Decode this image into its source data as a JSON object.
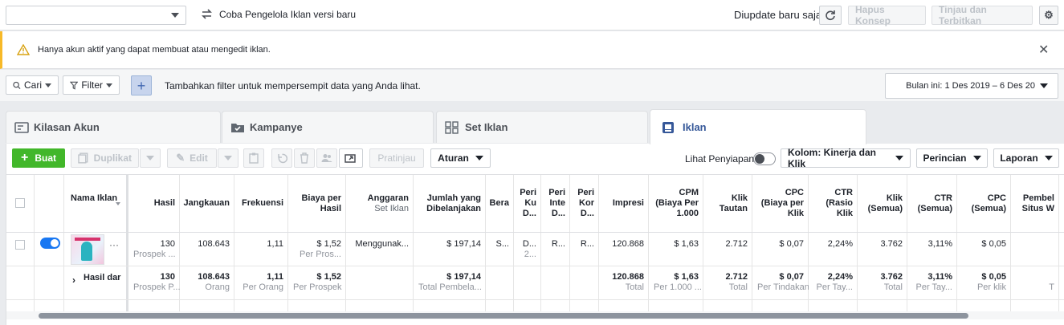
{
  "topbar": {
    "account_select_value": "",
    "try_new_label": "Coba Pengelola Iklan versi baru",
    "updated_label": "Diupdate baru saja",
    "delete_drafts_label": "Hapus Konsep",
    "review_publish_label": "Tinjau dan Terbitkan"
  },
  "notice": {
    "text": "Hanya akun aktif yang dapat membuat atau mengedit iklan."
  },
  "filterbar": {
    "search_label": "Cari",
    "filter_label": "Filter",
    "hint": "Tambahkan filter untuk mempersempit data yang Anda lihat.",
    "date_range": "Bulan ini: 1 Des 2019 – 6 Des 20"
  },
  "tabs": [
    {
      "label": "Kilasan Akun"
    },
    {
      "label": "Kampanye"
    },
    {
      "label": "Set Iklan"
    },
    {
      "label": "Iklan"
    }
  ],
  "toolbar": {
    "create": "Buat",
    "duplicate": "Duplikat",
    "edit": "Edit",
    "preview": "Pratinjau",
    "rules": "Aturan",
    "view_setup": "Lihat Penyiapan",
    "columns": "Kolom: Kinerja dan Klik",
    "breakdown": "Perincian",
    "reports": "Laporan"
  },
  "table": {
    "name_header": "Nama Iklan",
    "headers": [
      {
        "t": "Hasil",
        "s": ""
      },
      {
        "t": "Jangkauan",
        "s": ""
      },
      {
        "t": "Frekuensi",
        "s": ""
      },
      {
        "t": "Biaya per Hasil",
        "s": ""
      },
      {
        "t": "Anggaran",
        "s": "Set Iklan"
      },
      {
        "t": "Jumlah yang Dibelanjakan",
        "s": ""
      },
      {
        "t": "Bera",
        "s": ""
      },
      {
        "t": "Peri Ku D...",
        "s": ""
      },
      {
        "t": "Peri Inte D...",
        "s": ""
      },
      {
        "t": "Peri Kor D...",
        "s": ""
      },
      {
        "t": "Impresi",
        "s": ""
      },
      {
        "t": "CPM (Biaya Per 1.000",
        "s": ""
      },
      {
        "t": "Klik Tautan",
        "s": ""
      },
      {
        "t": "CPC (Biaya per Klik",
        "s": ""
      },
      {
        "t": "CTR (Rasio Klik",
        "s": ""
      },
      {
        "t": "Klik (Semua)",
        "s": ""
      },
      {
        "t": "CTR (Semua)",
        "s": ""
      },
      {
        "t": "CPC (Semua)",
        "s": ""
      },
      {
        "t": "Pembel Situs W",
        "s": ""
      }
    ],
    "row": [
      {
        "v": "130",
        "s": "Prospek ..."
      },
      {
        "v": "108.643",
        "s": ""
      },
      {
        "v": "1,11",
        "s": ""
      },
      {
        "v": "$ 1,52",
        "s": "Per Pros..."
      },
      {
        "v": "Menggunak...",
        "s": ""
      },
      {
        "v": "$ 197,14",
        "s": ""
      },
      {
        "v": "S...",
        "s": ""
      },
      {
        "v": "D...",
        "s": "2..."
      },
      {
        "v": "R...",
        "s": ""
      },
      {
        "v": "R...",
        "s": ""
      },
      {
        "v": "120.868",
        "s": ""
      },
      {
        "v": "$ 1,63",
        "s": ""
      },
      {
        "v": "2.712",
        "s": ""
      },
      {
        "v": "$ 0,07",
        "s": ""
      },
      {
        "v": "2,24%",
        "s": ""
      },
      {
        "v": "3.762",
        "s": ""
      },
      {
        "v": "3,11%",
        "s": ""
      },
      {
        "v": "$ 0,05",
        "s": ""
      },
      {
        "v": "",
        "s": ""
      }
    ],
    "total_label": "Hasil dar",
    "total": [
      {
        "v": "130",
        "s": "Prospek P..."
      },
      {
        "v": "108.643",
        "s": "Orang"
      },
      {
        "v": "1,11",
        "s": "Per Orang"
      },
      {
        "v": "$ 1,52",
        "s": "Per Prospek"
      },
      {
        "v": "",
        "s": ""
      },
      {
        "v": "$ 197,14",
        "s": "Total Pembela..."
      },
      {
        "v": "",
        "s": ""
      },
      {
        "v": "",
        "s": ""
      },
      {
        "v": "",
        "s": ""
      },
      {
        "v": "",
        "s": ""
      },
      {
        "v": "120.868",
        "s": "Total"
      },
      {
        "v": "$ 1,63",
        "s": "Per 1.000 ..."
      },
      {
        "v": "2.712",
        "s": "Total"
      },
      {
        "v": "$ 0,07",
        "s": "Per Tindakan"
      },
      {
        "v": "2,24%",
        "s": "Per Tay..."
      },
      {
        "v": "3.762",
        "s": "Total"
      },
      {
        "v": "3,11%",
        "s": "Per Tay..."
      },
      {
        "v": "$ 0,05",
        "s": "Per klik"
      },
      {
        "v": "",
        "s": "T"
      }
    ]
  },
  "colors": {
    "accent": "#1877f2",
    "create": "#42b72a",
    "warning": "#f7b928"
  }
}
